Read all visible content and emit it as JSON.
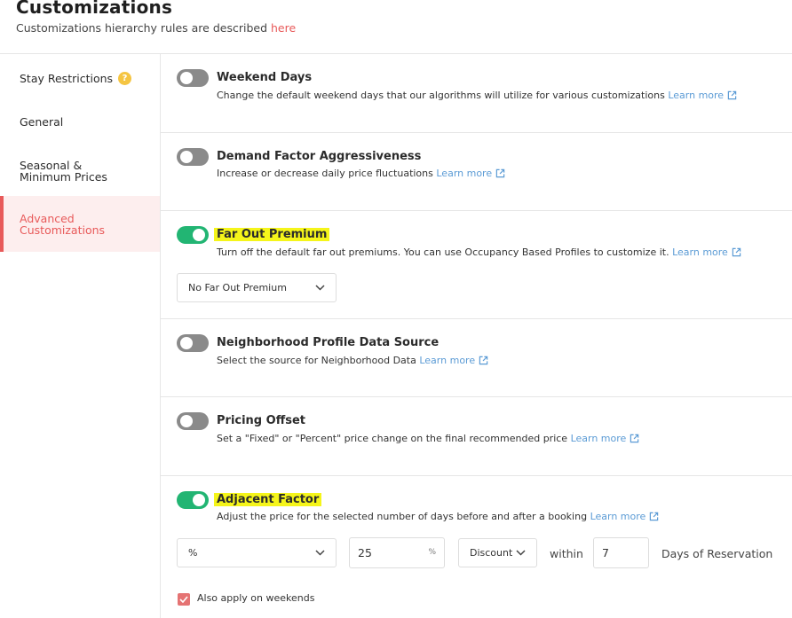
{
  "header": {
    "title": "Customizations",
    "subtitle_text": "Customizations hierarchy rules are described ",
    "subtitle_link": "here"
  },
  "sidebar": {
    "items": [
      {
        "label": "Stay Restrictions",
        "badge": "?"
      },
      {
        "label": "General"
      },
      {
        "label": "Seasonal & Minimum Prices"
      },
      {
        "label": "Advanced Customizations",
        "active": true
      }
    ]
  },
  "learn_more": "Learn more",
  "sections": {
    "weekend_days": {
      "title": "Weekend Days",
      "enabled": false,
      "desc": "Change the default weekend days that our algorithms will utilize for various customizations "
    },
    "demand_factor": {
      "title": "Demand Factor Aggressiveness",
      "enabled": false,
      "desc": "Increase or decrease daily price fluctuations "
    },
    "far_out": {
      "title": "Far Out Premium",
      "enabled": true,
      "desc": "Turn off the default far out premiums. You can use Occupancy Based Profiles to customize it. ",
      "select_value": "No Far Out Premium"
    },
    "neighborhood": {
      "title": "Neighborhood Profile Data Source",
      "enabled": false,
      "desc": "Select the source for Neighborhood Data "
    },
    "pricing_offset": {
      "title": "Pricing Offset",
      "enabled": false,
      "desc": "Set a \"Fixed\" or \"Percent\" price change on the final recommended price "
    },
    "adjacent": {
      "title": "Adjacent Factor",
      "enabled": true,
      "desc": "Adjust the price for the selected number of days before and after a booking ",
      "unit_select": "%",
      "amount": "25",
      "amount_suffix": "%",
      "type_select": "Discount",
      "within_label": "within",
      "days": "7",
      "days_label": "Days of Reservation",
      "weekends_checked": true,
      "weekends_label": "Also apply on weekends"
    }
  },
  "colors": {
    "accent": "#e85a5a",
    "toggle_on": "#22b573",
    "toggle_off": "#8a8a8a",
    "link": "#5b9bd5",
    "highlight": "#f5f51a"
  }
}
